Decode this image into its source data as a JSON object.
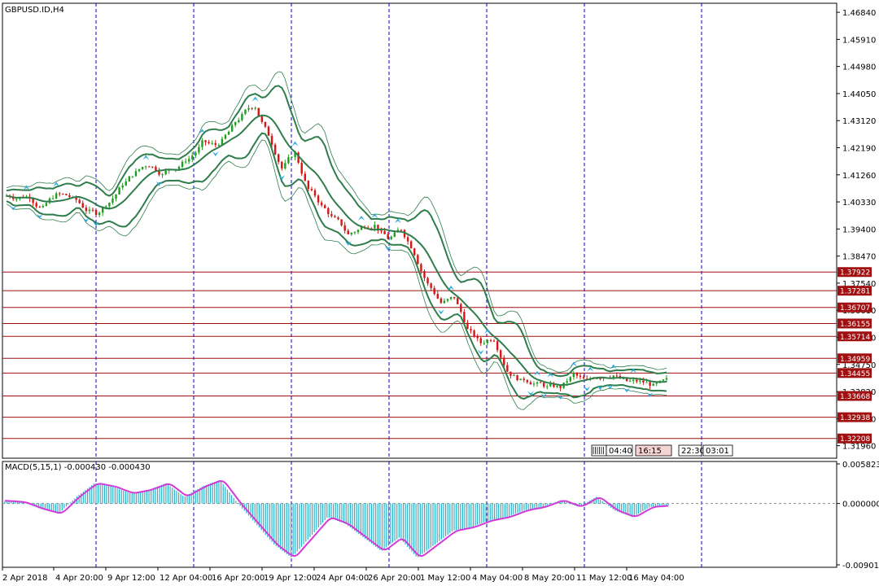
{
  "chart_data": [
    {
      "type": "candlestick",
      "title": "GBPUSD.ID,H4",
      "symbol": "GBPUSD.ID",
      "timeframe": "H4",
      "y_ticks": [
        "1.46840",
        "1.45910",
        "1.44980",
        "1.44050",
        "1.43120",
        "1.42190",
        "1.41260",
        "1.40330",
        "1.39400",
        "1.38470",
        "1.37540",
        "1.36610",
        "1.35680",
        "1.34750",
        "1.33820",
        "1.32890",
        "1.31960"
      ],
      "ylim": [
        1.3153,
        1.4715
      ],
      "price_levels": [
        {
          "label": "1.37922",
          "value": 1.37922
        },
        {
          "label": "1.37281",
          "value": 1.37281
        },
        {
          "label": "1.36707",
          "value": 1.36707
        },
        {
          "label": "1.36155",
          "value": 1.36155
        },
        {
          "label": "1.35714",
          "value": 1.35714
        },
        {
          "label": "1.34959",
          "value": 1.34959
        },
        {
          "label": "1.34455",
          "value": 1.34455
        },
        {
          "label": "1.33668",
          "value": 1.33668
        },
        {
          "label": "1.32938",
          "value": 1.32938
        },
        {
          "label": "1.32208",
          "value": 1.32208
        }
      ],
      "x_labels": [
        "2 Apr 2018",
        "4 Apr 20:00",
        "9 Apr 12:00",
        "12 Apr 04:00",
        "16 Apr 20:00",
        "19 Apr 12:00",
        "24 Apr 04:00",
        "26 Apr 20:00",
        "1 May 12:00",
        "4 May 04:00",
        "8 May 20:00",
        "11 May 12:00",
        "16 May 04:00"
      ],
      "close_series": [
        1.406,
        1.4072,
        1.4048,
        1.4085,
        1.407,
        1.403,
        1.4005,
        1.406,
        1.412,
        1.416,
        1.419,
        1.4175,
        1.4205,
        1.424,
        1.429,
        1.427,
        1.431,
        1.436,
        1.439,
        1.429,
        1.42,
        1.424,
        1.412,
        1.406,
        1.401,
        1.395,
        1.3975,
        1.401,
        1.396,
        1.398,
        1.392,
        1.383,
        1.377,
        1.3775,
        1.367,
        1.361,
        1.364,
        1.356,
        1.3535,
        1.354,
        1.352,
        1.351,
        1.3545,
        1.3505,
        1.353,
        1.356,
        1.3525,
        1.3515,
        1.35,
        1.349
      ],
      "sessions": [
        "04:40",
        "16:15",
        "22:30",
        "03:01"
      ]
    },
    {
      "type": "bar",
      "title": "MACD(5,15,1) -0.000430 -0.000430",
      "y_ticks": [
        "0.005823",
        "0.000000",
        "-0.009017"
      ],
      "ylim": [
        -0.009017,
        0.005823
      ],
      "values": [
        0.0004,
        0.0002,
        -0.0008,
        -0.0015,
        0.001,
        0.003,
        0.0025,
        0.0015,
        0.002,
        0.003,
        0.001,
        0.0025,
        0.0035,
        0.0,
        -0.003,
        -0.006,
        -0.008,
        -0.005,
        -0.002,
        -0.003,
        -0.005,
        -0.007,
        -0.005,
        -0.008,
        -0.006,
        -0.004,
        -0.0035,
        -0.0025,
        -0.002,
        -0.001,
        -0.0005,
        0.0005,
        -0.0005,
        0.001,
        -0.001,
        -0.002,
        -0.0005,
        -0.0003
      ]
    }
  ]
}
